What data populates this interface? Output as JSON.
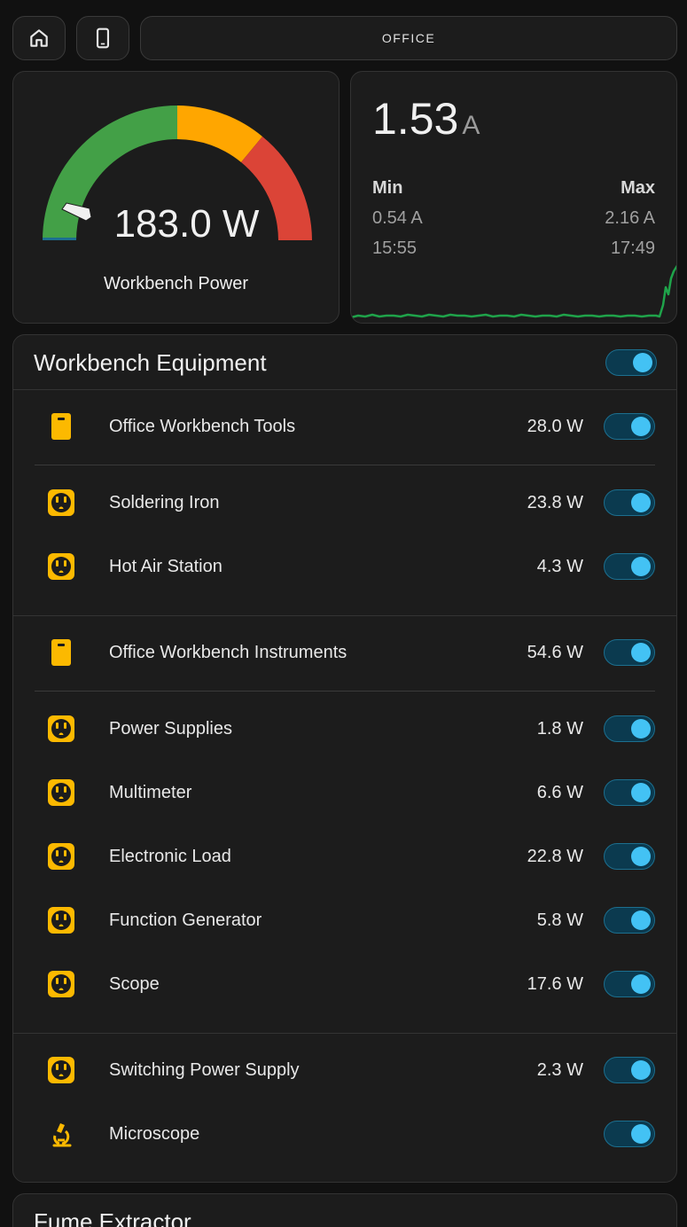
{
  "nav": {
    "title": "OFFICE"
  },
  "gauge": {
    "value_text": "183.0 W",
    "name": "Workbench Power",
    "value": 183.0,
    "fraction": 0.0,
    "colors": {
      "green": "#43a047",
      "yellow": "#ffa600",
      "red": "#db4437"
    }
  },
  "current": {
    "value": "1.53",
    "unit": "A",
    "min_label": "Min",
    "min_value": "0.54 A",
    "min_time": "15:55",
    "max_label": "Max",
    "max_value": "2.16 A",
    "max_time": "17:49",
    "line_color": "#1fa34a"
  },
  "equipment": {
    "title": "Workbench Equipment",
    "master_on": true,
    "rows": [
      {
        "label": "Office Workbench Tools",
        "power": "28.0 W",
        "icon": "power-strip-icon",
        "on": true
      },
      {
        "label": "Soldering Iron",
        "power": "23.8 W",
        "icon": "power-socket-icon",
        "on": true
      },
      {
        "label": "Hot Air Station",
        "power": "4.3 W",
        "icon": "power-socket-icon",
        "on": true
      },
      {
        "label": "Office Workbench Instruments",
        "power": "54.6 W",
        "icon": "power-strip-icon",
        "on": true
      },
      {
        "label": "Power Supplies",
        "power": "1.8 W",
        "icon": "power-socket-icon",
        "on": true
      },
      {
        "label": "Multimeter",
        "power": "6.6 W",
        "icon": "power-socket-icon",
        "on": true
      },
      {
        "label": "Electronic Load",
        "power": "22.8 W",
        "icon": "power-socket-icon",
        "on": true
      },
      {
        "label": "Function Generator",
        "power": "5.8 W",
        "icon": "power-socket-icon",
        "on": true
      },
      {
        "label": "Scope",
        "power": "17.6 W",
        "icon": "power-socket-icon",
        "on": true
      },
      {
        "label": "Switching Power Supply",
        "power": "2.3 W",
        "icon": "power-socket-icon",
        "on": true
      },
      {
        "label": "Microscope",
        "power": "",
        "icon": "microscope-icon",
        "on": true
      }
    ]
  },
  "fume": {
    "title": "Fume Extractor"
  },
  "colors": {
    "accent": "#43c2f4",
    "icon_yellow": "#fcb900"
  }
}
